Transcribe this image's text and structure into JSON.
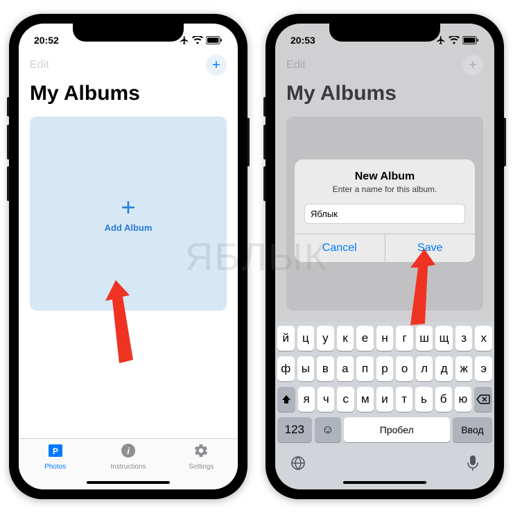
{
  "watermark": "ЯБЛЫК",
  "left": {
    "status": {
      "time": "20:52"
    },
    "nav": {
      "edit": "Edit",
      "add": "+"
    },
    "title": "My Albums",
    "album": {
      "add_label": "Add Album"
    },
    "tabs": {
      "photos": "Photos",
      "instructions": "Instructions",
      "settings": "Settings"
    }
  },
  "right": {
    "status": {
      "time": "20:53"
    },
    "nav": {
      "edit": "Edit"
    },
    "title": "My Albums",
    "alert": {
      "title": "New Album",
      "subtitle": "Enter a name for this album.",
      "value": "Яблык",
      "cancel": "Cancel",
      "save": "Save"
    },
    "keyboard": {
      "row1": [
        "й",
        "ц",
        "у",
        "к",
        "е",
        "н",
        "г",
        "ш",
        "щ",
        "з",
        "х"
      ],
      "row2": [
        "ф",
        "ы",
        "в",
        "а",
        "п",
        "р",
        "о",
        "л",
        "д",
        "ж",
        "э"
      ],
      "row3": [
        "я",
        "ч",
        "с",
        "м",
        "и",
        "т",
        "ь",
        "б",
        "ю"
      ],
      "shift": "⇧",
      "backspace": "⌫",
      "numbers": "123",
      "emoji": "☺",
      "space": "Пробел",
      "enter": "Ввод",
      "globe": "🌐",
      "mic": "🎤"
    }
  }
}
